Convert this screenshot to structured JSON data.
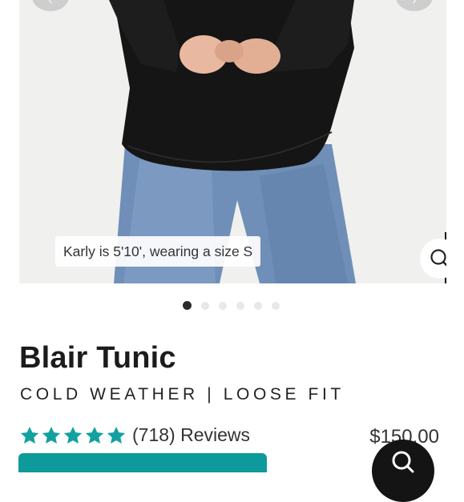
{
  "gallery": {
    "model_caption": "Karly is 5'10', wearing a size S",
    "dot_count": 6,
    "active_index": 0,
    "icons": {
      "prev": "chevron-left-icon",
      "next": "chevron-right-icon",
      "zoom": "search-icon"
    }
  },
  "product": {
    "name": "Blair Tunic",
    "tagline": "COLD WEATHER | LOOSE FIT",
    "rating": 5,
    "reviews": "(718) Reviews",
    "price": "$150.00"
  },
  "colors": {
    "accent": "#0e9a9a",
    "star": "#14a0a0",
    "ink": "#1c1c1c"
  },
  "chat": {
    "icon": "chat-icon"
  }
}
